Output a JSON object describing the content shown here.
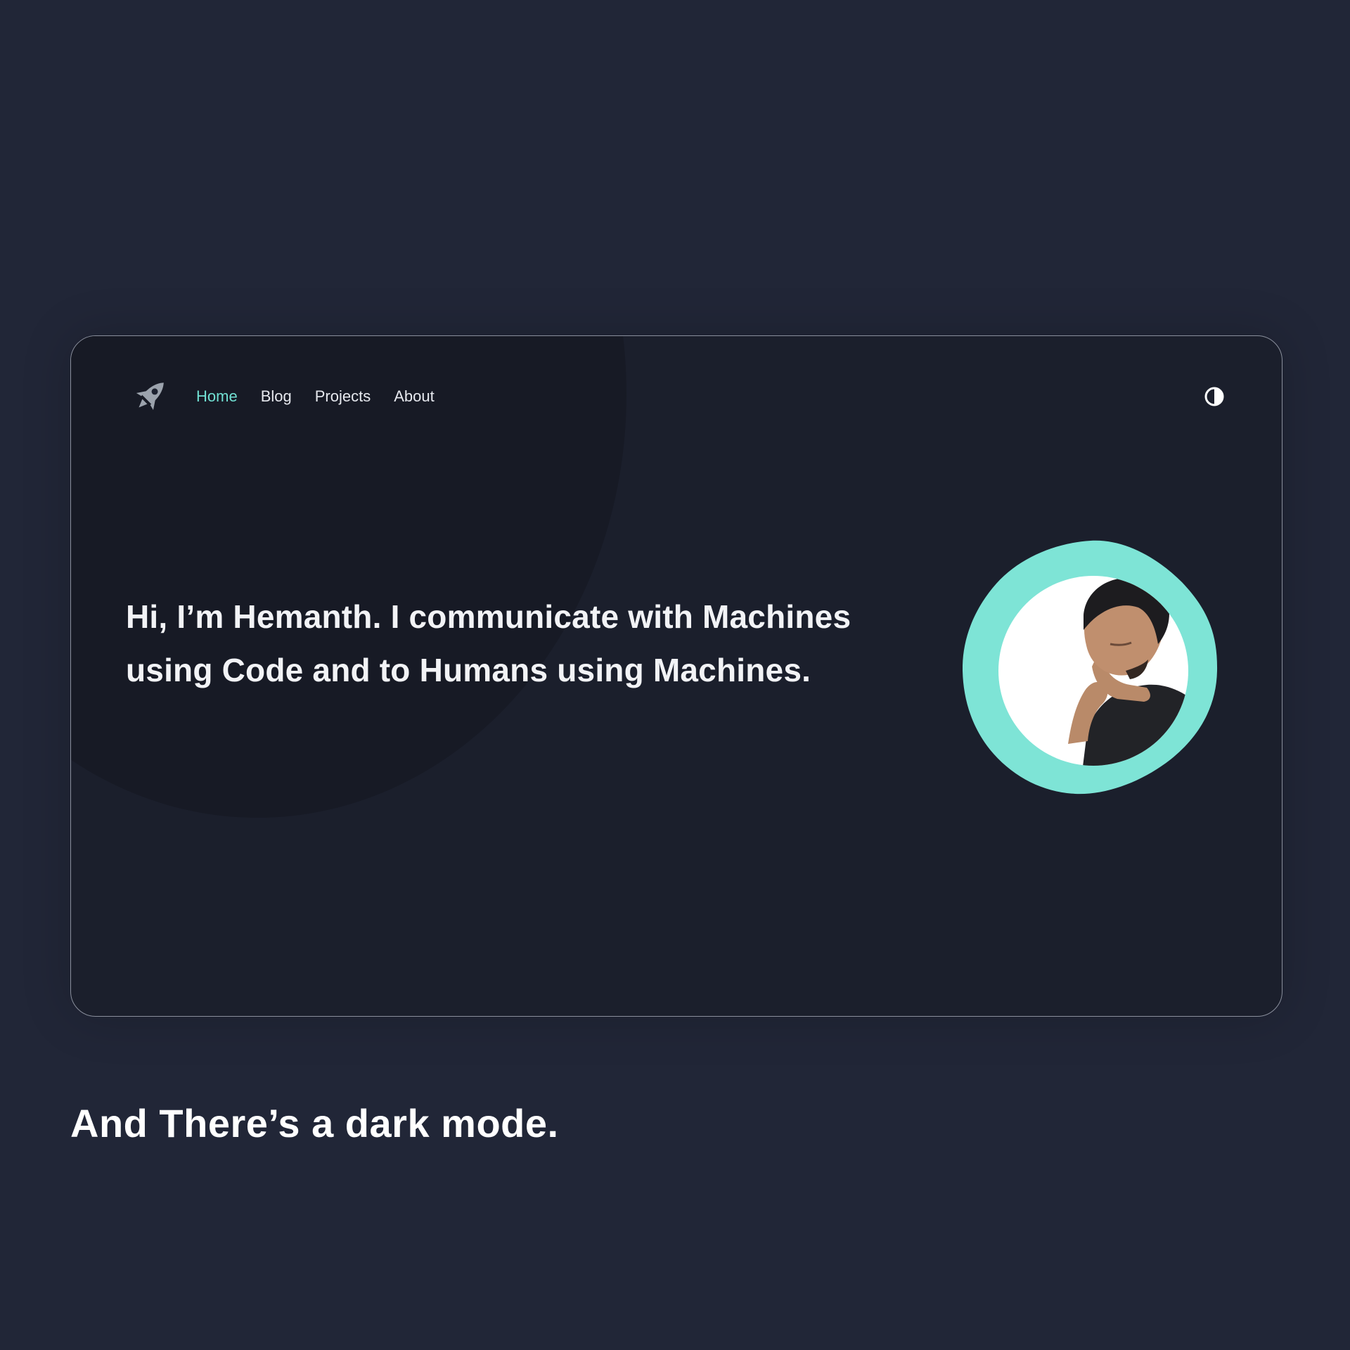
{
  "nav": {
    "logo_icon": "rocket-icon",
    "links": [
      {
        "label": "Home",
        "active": true
      },
      {
        "label": "Blog",
        "active": false
      },
      {
        "label": "Projects",
        "active": false
      },
      {
        "label": "About",
        "active": false
      }
    ],
    "theme_toggle_icon": "contrast-icon"
  },
  "hero": {
    "heading": "Hi, I’m Hemanth. I communicate with Machines using Code and to Humans using Machines.",
    "avatar_icon": "profile-photo"
  },
  "caption": "And There’s a dark mode.",
  "colors": {
    "accent": "#71e0d3",
    "background": "#212637",
    "card": "#1b1f2c",
    "text": "#f2f3f6"
  }
}
